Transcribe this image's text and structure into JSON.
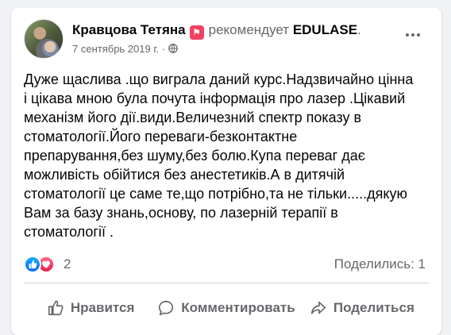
{
  "post": {
    "author": "Кравцова Тетяна",
    "recommends_label": "рекомендует",
    "page_name": "EDULASE",
    "page_name_suffix": ".",
    "date": "7 сентябрь 2019 г.",
    "meta_separator": " · ",
    "text": "Дуже щаслива .що виграла даний курс.Надзвичайно цінна\nі цікава мною була почута інформація про лазер .Цікавий\nмеханізм його дії.види.Величезний спектр показу в\nстоматології.Його переваги-безконтактне\nпрепарування,без шуму,без болю.Купа переваг дає\nможливість обійтися без анестетиків.А в дитячій\nстоматології це саме те,що потрібно,та не тільки.....дякую\nВам за базу знань,основу, по лазерній терапії в\nстоматології ."
  },
  "reactions": {
    "count": "2",
    "shares": "Поделились: 1"
  },
  "actions": {
    "like": "Нравится",
    "comment": "Комментировать",
    "share": "Поделиться"
  },
  "colors": {
    "recommend_badge": "#f3425f",
    "like_blue": "#0866ff",
    "love_red": "#e61e4d",
    "secondary_text": "#65676b"
  },
  "icons": {
    "recommend": "recommend-flag-icon",
    "privacy": "globe-icon",
    "like": "thumbs-up-icon",
    "love": "heart-icon",
    "comment": "speech-bubble-icon",
    "share": "share-arrow-icon",
    "more": "more-horizontal-icon"
  }
}
